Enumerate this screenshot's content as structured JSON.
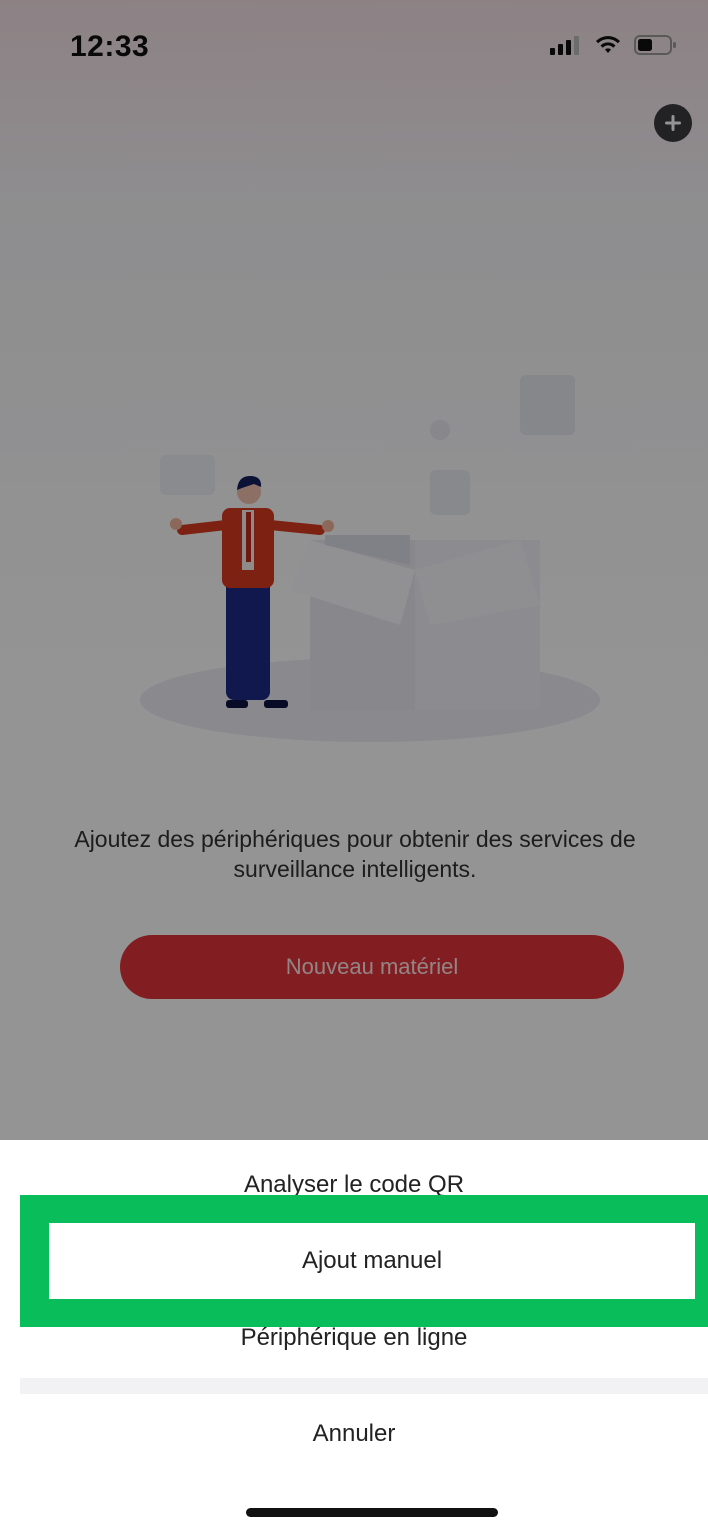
{
  "status_bar": {
    "time": "12:33",
    "icons": [
      "cellular-signal-icon",
      "wifi-icon",
      "battery-icon"
    ]
  },
  "header": {
    "add_icon": "plus-circle-icon"
  },
  "main": {
    "illustration": "person-with-open-box-illustration",
    "empty_message": "Ajoutez des périphériques pour obtenir des services de surveillance intelligents.",
    "new_device_button": "Nouveau matériel"
  },
  "action_sheet": {
    "items": [
      {
        "label": "Analyser le code QR"
      },
      {
        "label": "Ajout manuel",
        "highlighted": true
      },
      {
        "label": "Périphérique en ligne"
      }
    ],
    "cancel_label": "Annuler"
  },
  "colors": {
    "accent_red": "#e0343c",
    "highlight_green": "#08bd5a",
    "overlay": "rgba(0,0,0,0.42)"
  }
}
